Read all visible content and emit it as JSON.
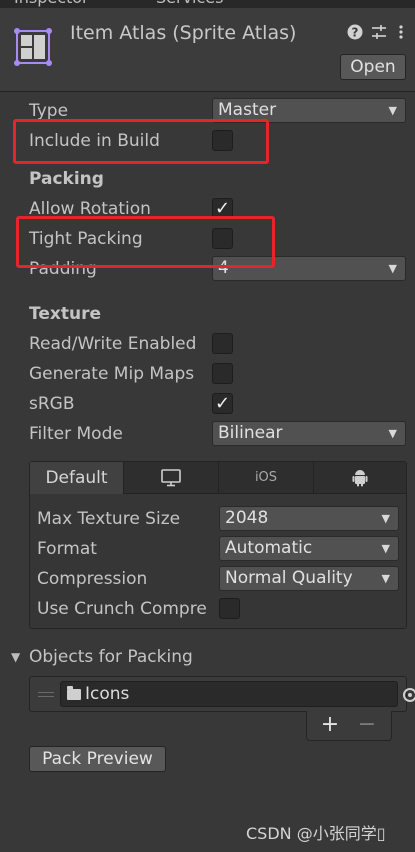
{
  "tabs": [
    {
      "label": "Inspector"
    },
    {
      "label": "Services"
    }
  ],
  "header": {
    "title": "Item Atlas (Sprite Atlas)",
    "help_icon": "help-icon",
    "settings_icon": "preset-sliders-icon",
    "menu_icon": "more-vert-icon",
    "open_label": "Open"
  },
  "fields": {
    "type": {
      "label": "Type",
      "value": "Master"
    },
    "include_in_build": {
      "label": "Include in Build",
      "checked": false
    },
    "packing_heading": "Packing",
    "allow_rotation": {
      "label": "Allow Rotation",
      "checked": true
    },
    "tight_packing": {
      "label": "Tight Packing",
      "checked": false
    },
    "padding": {
      "label": "Padding",
      "value": "4"
    },
    "texture_heading": "Texture",
    "read_write": {
      "label": "Read/Write Enabled",
      "checked": false
    },
    "mipmaps": {
      "label": "Generate Mip Maps",
      "checked": false
    },
    "srgb": {
      "label": "sRGB",
      "checked": true
    },
    "filter_mode": {
      "label": "Filter Mode",
      "value": "Bilinear"
    }
  },
  "platform_tabs": [
    {
      "label": "Default",
      "active": true
    },
    {
      "icon": "monitor-icon"
    },
    {
      "label": "iOS"
    },
    {
      "icon": "android-icon"
    }
  ],
  "platform_settings": {
    "max_texture_size": {
      "label": "Max Texture Size",
      "value": "2048"
    },
    "format": {
      "label": "Format",
      "value": "Automatic"
    },
    "compression": {
      "label": "Compression",
      "value": "Normal Quality"
    },
    "crunch": {
      "label": "Use Crunch Compre",
      "checked": false
    }
  },
  "objects": {
    "heading": "Objects for Packing",
    "items": [
      {
        "name": "Icons"
      }
    ],
    "add_label": "+",
    "remove_label": "−"
  },
  "pack_preview_label": "Pack Preview",
  "watermark": "CSDN @小张同学▯",
  "colors": {
    "background": "#383838",
    "highlight": "#e6252a",
    "atlas_icon_accent": "#a78bf0"
  }
}
